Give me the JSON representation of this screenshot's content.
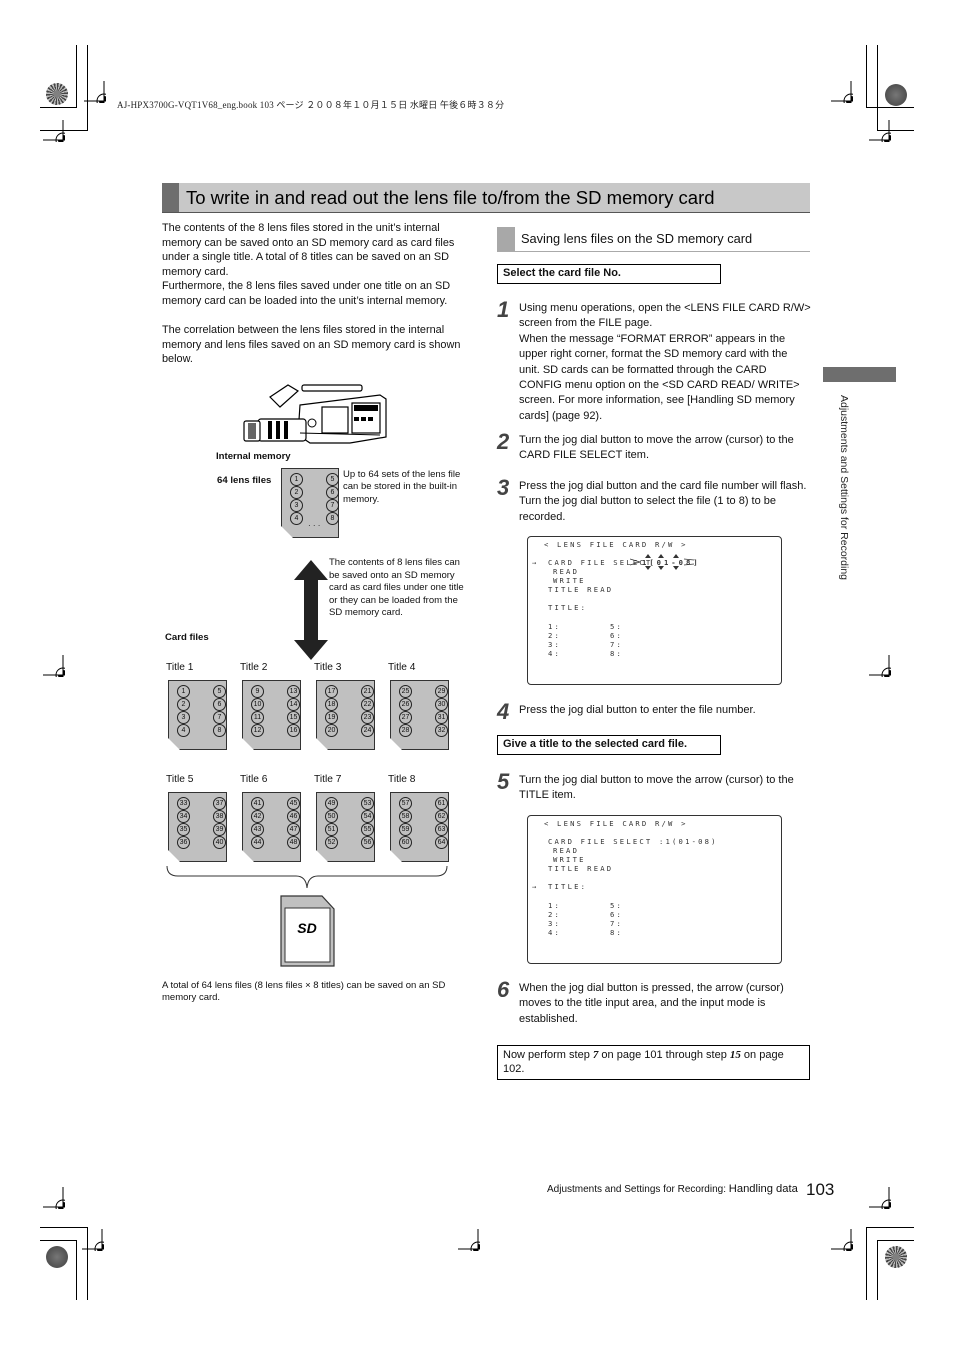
{
  "print_header": "AJ-HPX3700G-VQT1V68_eng.book  103 ページ  ２００８年１０月１５日  水曜日  午後６時３８分",
  "section_title": "To write in and read out the lens file to/from the SD memory card",
  "intro": {
    "p1": "The contents of the 8 lens files stored in the unit’s internal memory can be saved onto an SD memory card as card files under a single title. A total of 8 titles can be saved on an SD memory card.",
    "p2": "Furthermore, the 8 lens files saved under one title on an SD memory card can be loaded into the unit’s internal memory.",
    "p3": "The correlation between the lens files stored in the internal memory and lens files saved on an SD memory card is shown below."
  },
  "diagram": {
    "internal_memory_label": "Internal memory",
    "lens_files_label": "64 lens files",
    "internal_files": [
      "1",
      "2",
      "3",
      "4",
      "5",
      "6",
      "7",
      "8"
    ],
    "internal_ellipsis": "· · ·",
    "internal_note": "Up to 64 sets of the lens file can be stored in the built-in memory.",
    "arrow_note": "The contents of 8 lens files can be saved onto an SD memory card as card files under one title or they can be loaded from the SD memory card.",
    "card_files_label": "Card files",
    "titles": [
      {
        "label": "Title 1",
        "files": [
          "1",
          "2",
          "3",
          "4",
          "5",
          "6",
          "7",
          "8"
        ]
      },
      {
        "label": "Title 2",
        "files": [
          "9",
          "10",
          "11",
          "12",
          "13",
          "14",
          "15",
          "16"
        ]
      },
      {
        "label": "Title 3",
        "files": [
          "17",
          "18",
          "19",
          "20",
          "21",
          "22",
          "23",
          "24"
        ]
      },
      {
        "label": "Title 4",
        "files": [
          "25",
          "26",
          "27",
          "28",
          "29",
          "30",
          "31",
          "32"
        ]
      },
      {
        "label": "Title 5",
        "files": [
          "33",
          "34",
          "35",
          "36",
          "37",
          "38",
          "39",
          "40"
        ]
      },
      {
        "label": "Title 6",
        "files": [
          "41",
          "42",
          "43",
          "44",
          "45",
          "46",
          "47",
          "48"
        ]
      },
      {
        "label": "Title 7",
        "files": [
          "49",
          "50",
          "51",
          "52",
          "53",
          "54",
          "55",
          "56"
        ]
      },
      {
        "label": "Title 8",
        "files": [
          "57",
          "58",
          "59",
          "60",
          "61",
          "62",
          "63",
          "64"
        ]
      }
    ],
    "sd_logo": "SD",
    "caption": "A total of 64 lens files (8 lens files × 8 titles) can be saved on an SD memory card."
  },
  "subsection": {
    "title": "Saving lens files on the SD memory card",
    "box1": "Select the card file No.",
    "box2": "Give a title to the selected card file."
  },
  "steps": [
    {
      "num": "1",
      "lines": [
        "Using menu operations, open the <LENS FILE CARD R/W> screen from the FILE page.",
        "When the message “FORMAT ERROR” appears in the upper right corner, format the SD memory card with the unit. SD cards can be formatted through the CARD CONFIG menu option on the <SD CARD READ/ WRITE> screen. For more information, see [Handling SD memory cards] (page 92)."
      ]
    },
    {
      "num": "2",
      "lines": [
        "Turn the jog dial button to move the arrow (cursor) to the CARD FILE SELECT item."
      ]
    },
    {
      "num": "3",
      "lines": [
        "Press the jog dial button and the card file number will flash. Turn the jog dial button to select the file (1 to 8) to be recorded."
      ]
    },
    {
      "num": "4",
      "lines": [
        "Press the jog dial button to enter the file number."
      ]
    },
    {
      "num": "5",
      "lines": [
        "Turn the jog dial button to move the arrow (cursor) to the TITLE item."
      ]
    },
    {
      "num": "6",
      "lines": [
        "When the jog dial button is pressed, the arrow (cursor) moves to the title input area, and the input mode is established."
      ]
    }
  ],
  "screen1": {
    "header": "< LENS FILE CARD R/W >",
    "cursor": "→",
    "card_file_select": "CARD FILE SELECT",
    "select_value": "1[01-08]",
    "read": "READ",
    "write": "WRITE",
    "title_read": "TITLE READ",
    "title": "TITLE:",
    "slots": [
      "1:",
      "2:",
      "3:",
      "4:",
      "5:",
      "6:",
      "7:",
      "8:"
    ]
  },
  "screen2": {
    "header": "< LENS FILE CARD R/W >",
    "cursor": "→",
    "card_file_select": "CARD FILE SELECT :1(01-08)",
    "read": "READ",
    "write": "WRITE",
    "title_read": "TITLE READ",
    "title": "TITLE:",
    "slots": [
      "1:",
      "2:",
      "3:",
      "4:",
      "5:",
      "6:",
      "7:",
      "8:"
    ]
  },
  "note": {
    "prefix": "Now perform step ",
    "step_a": "7",
    "mid": " on page 101 through step ",
    "step_b": "15",
    "suffix": " on page 102."
  },
  "side_tab_text": "Adjustments and Settings for Recording",
  "footer": {
    "section": "Adjustments and Settings for Recording: ",
    "topic": "Handling data",
    "page_number": "103"
  }
}
